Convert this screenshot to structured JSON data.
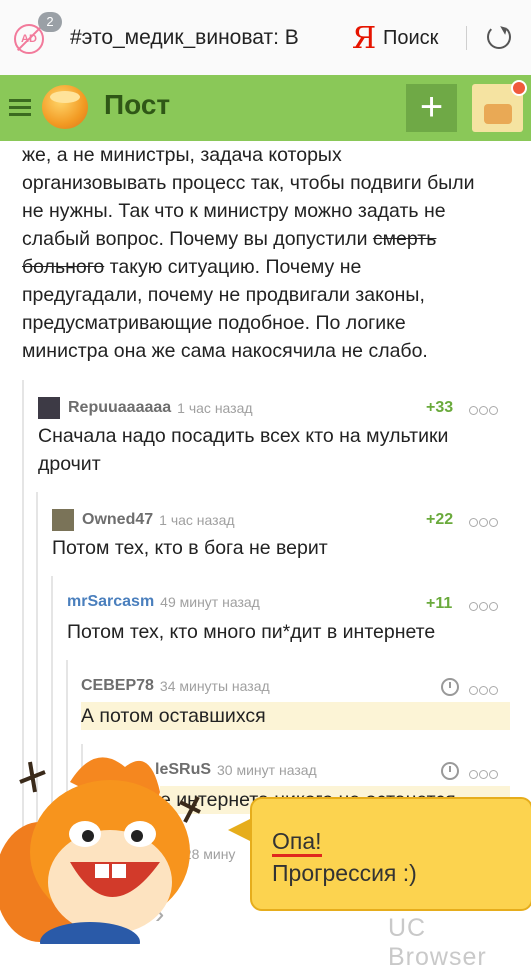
{
  "browser": {
    "ad_count": "2",
    "ad_icon_label": "AD",
    "url": "#это_медик_виноват: В",
    "search_brand": "Я",
    "search_label": "Поиск"
  },
  "header": {
    "title": "Пост",
    "add_label": "+",
    "accent": "#8ac858"
  },
  "post": {
    "line1": "же, а не министры, задача которых",
    "line2": "организовывать процесс так, чтобы подвиги были",
    "line3": "не нужны. Так что к министру можно задать не",
    "line4a": "слабый вопрос. Почему вы допустили ",
    "line4_strike": "смерть",
    "line5_strike": "больного",
    "line5b": " такую ситуацию. Почему не",
    "line6": "предугадали, почему не продвигали законы,",
    "line7": "предусматривающие подобное. По логике",
    "line8": "министра она же сама накосячила не слабо."
  },
  "comments": [
    {
      "author": "Repuuaaaaaa",
      "time": "1 час назад",
      "score": "+33",
      "text1": "Сначала надо посадить всех кто на мультики",
      "text2": "дрочит"
    },
    {
      "author": "Owned47",
      "time": "1 час назад",
      "score": "+22",
      "text1": "Потом тех, кто в бога не верит"
    },
    {
      "author": "mrSarcasm",
      "time": "49 минут назад",
      "score": "+11",
      "text1": "Потом тех, кто много пи*дит в интернете"
    },
    {
      "author": "СЕВЕР78",
      "time": "34 минуты назад",
      "text1": "А потом оставшихся"
    },
    {
      "author": "leSRuS",
      "time": "30 минут назад",
      "text1": "е интернета никого не останется"
    },
    {
      "author": "78",
      "time": "28 мину"
    }
  ],
  "overlay": {
    "bubble_line1": "Опа!",
    "bubble_line2": "Прогрессия :)",
    "watermark": "UC Browser",
    "chevron": "›"
  }
}
